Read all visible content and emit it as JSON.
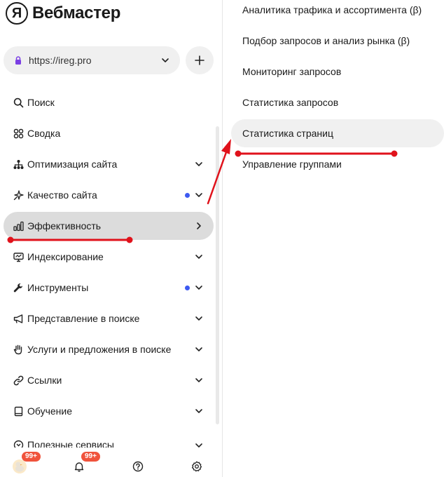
{
  "app": {
    "logo_letter": "Я",
    "logo_text": "Вебмастер"
  },
  "site_selector": {
    "url": "https://ireg.pro"
  },
  "menu": [
    {
      "label": "Поиск",
      "icon": "search-icon",
      "right": "none"
    },
    {
      "label": "Сводка",
      "icon": "dashboard-icon",
      "right": "none"
    },
    {
      "label": "Оптимизация сайта",
      "icon": "sitemap-icon",
      "right": "chevron-down"
    },
    {
      "label": "Качество сайта",
      "icon": "sparkle-icon",
      "right": "chevron-down",
      "dot": true
    },
    {
      "label": "Эффективность",
      "icon": "bar-chart-icon",
      "right": "chevron-right",
      "active": true
    },
    {
      "label": "Индексирование",
      "icon": "monitor-icon",
      "right": "chevron-down"
    },
    {
      "label": "Инструменты",
      "icon": "wrench-icon",
      "right": "chevron-down",
      "dot": true
    },
    {
      "label": "Представление в поиске",
      "icon": "megaphone-icon",
      "right": "chevron-down"
    },
    {
      "label": "Услуги и предложения в поиске",
      "icon": "handshake-icon",
      "right": "chevron-down"
    },
    {
      "label": "Ссылки",
      "icon": "link-icon",
      "right": "chevron-down"
    },
    {
      "label": "Обучение",
      "icon": "book-icon",
      "right": "chevron-down"
    },
    {
      "label": "Полезные сервисы",
      "icon": "services-icon",
      "right": "chevron-down"
    }
  ],
  "submenu": [
    {
      "label": "Аналитика трафика и ассортимента (β)"
    },
    {
      "label": "Подбор запросов и анализ рынка (β)"
    },
    {
      "label": "Мониторинг запросов"
    },
    {
      "label": "Статистика запросов"
    },
    {
      "label": "Статистика страниц",
      "hover": true
    },
    {
      "label": "Управление группами"
    }
  ],
  "bottom_bar": {
    "avatar_badge": "99+",
    "notifications_badge": "99+"
  },
  "colors": {
    "accent_dot": "#3d5af1",
    "badge": "#f0533c",
    "annotation": "#e0121b",
    "active_bg": "#dcdcdc"
  }
}
